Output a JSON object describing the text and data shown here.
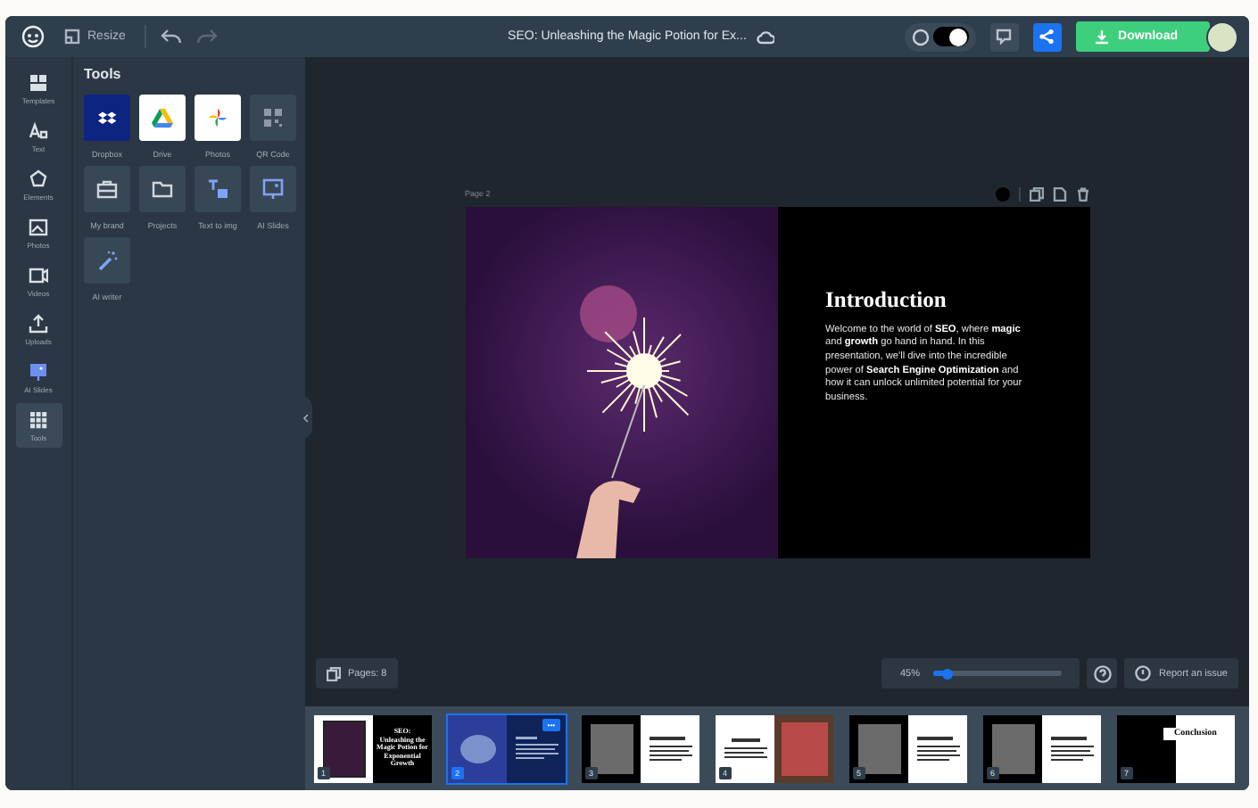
{
  "topbar": {
    "resize": "Resize",
    "title": "SEO: Unleashing the Magic Potion for Ex...",
    "theme_toggle": {
      "on": true
    },
    "download": "Download"
  },
  "rail": [
    {
      "label": "Templates",
      "kind": "templates",
      "selected": false
    },
    {
      "label": "Text",
      "kind": "text",
      "selected": false
    },
    {
      "label": "Elements",
      "kind": "elements",
      "selected": false
    },
    {
      "label": "Photos",
      "kind": "photos",
      "selected": false
    },
    {
      "label": "Videos",
      "kind": "videos",
      "selected": false
    },
    {
      "label": "Uploads",
      "kind": "uploads",
      "selected": false
    },
    {
      "label": "AI Slides",
      "kind": "aislides",
      "selected": false
    },
    {
      "label": "Tools",
      "kind": "tools",
      "selected": true
    }
  ],
  "tools_panel": {
    "heading": "Tools",
    "tiles": [
      {
        "label": "Dropbox",
        "kind": "dropbox"
      },
      {
        "label": "Drive",
        "kind": "drive"
      },
      {
        "label": "Photos",
        "kind": "photos"
      },
      {
        "label": "QR Code",
        "kind": "qr"
      },
      {
        "label": "My brand",
        "kind": "brand"
      },
      {
        "label": "Projects",
        "kind": "projects"
      },
      {
        "label": "Text to img",
        "kind": "textimg"
      },
      {
        "label": "AI Slides",
        "kind": "aislides"
      },
      {
        "label": "AI writer",
        "kind": "writer"
      }
    ]
  },
  "canvas": {
    "page_label": "Page 2",
    "slide": {
      "heading": "Introduction",
      "body": "Welcome to the world of **SEO**, where **magic** and **growth** go hand in hand. In this presentation, we'll dive into the incredible power of **Search Engine Optimization** and how it can unlock unlimited potential for your business."
    }
  },
  "bottom_bar": {
    "pages": "Pages: 8",
    "zoom": {
      "reading": "45%",
      "level": 0.1
    },
    "report": "Report an issue"
  },
  "thumbnails": [
    {
      "number": "1",
      "selected": false,
      "kind": "title",
      "text": "SEO: Unleashing the Magic Potion for Exponential Growth"
    },
    {
      "number": "2",
      "selected": true,
      "kind": "intro",
      "more": "•••"
    },
    {
      "number": "3",
      "selected": false,
      "kind": "photo-left"
    },
    {
      "number": "4",
      "selected": false,
      "kind": "photo-right"
    },
    {
      "number": "5",
      "selected": false,
      "kind": "photo-left"
    },
    {
      "number": "6",
      "selected": false,
      "kind": "photo-left"
    },
    {
      "number": "7",
      "selected": false,
      "kind": "end",
      "text": "Conclusion"
    }
  ]
}
